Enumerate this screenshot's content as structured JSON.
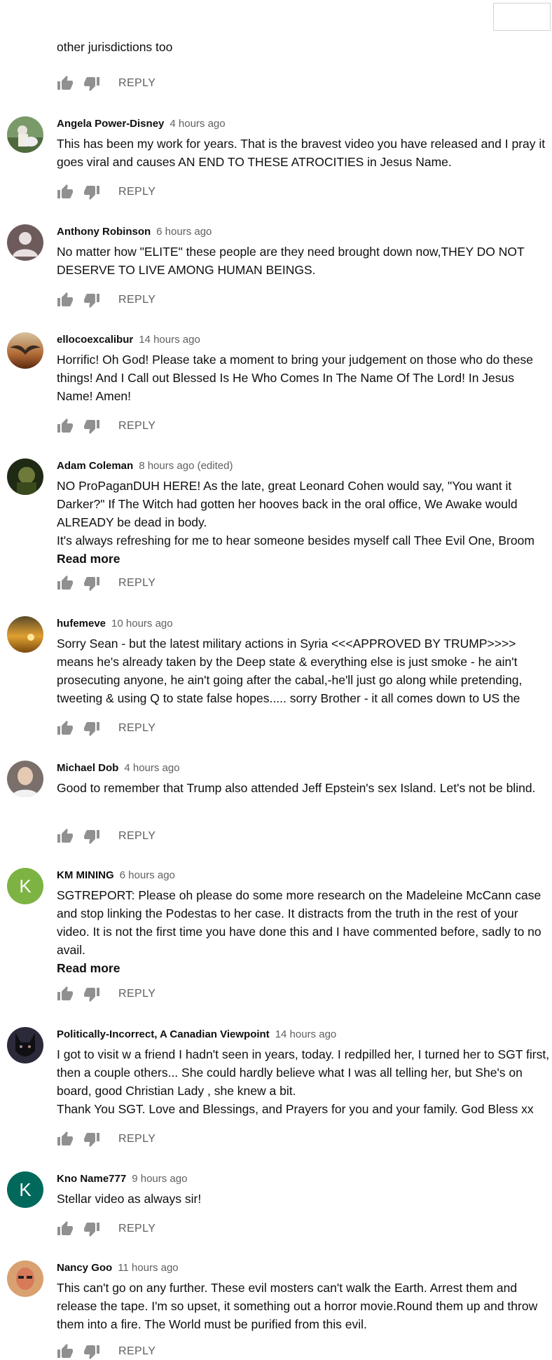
{
  "first": {
    "text": "other jurisdictions too",
    "reply_label": "REPLY"
  },
  "reply_label": "REPLY",
  "read_more_label": "Read more",
  "colors": {
    "like_icon": "#909090",
    "author": "#0f0f0f",
    "time": "#606060",
    "km_avatar": "#7cb342",
    "kno_avatar": "#00695c"
  },
  "comments": [
    {
      "author": "Angela Power-Disney",
      "time": "4 hours ago",
      "lines": [
        "This has been my work for years. That is the bravest video you have released and I pray it goes viral and causes AN END TO THESE ATROCITIES in Jesus Name."
      ],
      "read_more": false
    },
    {
      "author": "Anthony Robinson",
      "time": "6 hours ago",
      "lines": [
        "No matter how \"ELITE\" these people are they need brought down now,THEY DO NOT DESERVE TO LIVE AMONG HUMAN BEINGS."
      ],
      "read_more": false
    },
    {
      "author": "ellocoexcalibur",
      "time": "14 hours ago",
      "lines": [
        "Horrific! Oh God! Please take a moment to bring your judgement on those who do these things! And I Call out Blessed Is He Who Comes In The Name Of The Lord! In Jesus Name! Amen!"
      ],
      "read_more": false
    },
    {
      "author": "Adam Coleman",
      "time": "8 hours ago (edited)",
      "lines": [
        "NO ProPaganDUH HERE! As the late, great Leonard Cohen would say, \"You want it Darker?\" If The Witch had gotten her hooves back in the oral office, We Awake would ALREADY be dead in body.",
        "It's always refreshing for me to hear someone besides myself call Thee Evil One, Broom"
      ],
      "read_more": true
    },
    {
      "author": "hufemeve",
      "time": "10 hours ago",
      "lines": [
        "Sorry Sean - but the latest military actions in Syria <<<APPROVED BY TRUMP>>>> means he's already taken by the Deep state & everything else is just smoke - he ain't prosecuting anyone, he ain't going after the cabal,-he'll just go along while pretending, tweeting & using Q to state false hopes..... sorry Brother - it all comes down to US the"
      ],
      "read_more": false
    },
    {
      "author": "Michael Dob",
      "time": "4 hours ago",
      "lines": [
        "Good to remember that Trump also attended Jeff Epstein's sex Island. Let's not be blind."
      ],
      "read_more": false
    },
    {
      "author": "KM MINING",
      "time": "6 hours ago",
      "avatar_letter": "K",
      "lines": [
        "SGTREPORT:  Please oh please do some more research on the Madeleine McCann case and stop linking the Podestas to her case. It distracts from the truth in the rest of your video. It is not the first time you have done this and I have commented before, sadly to no avail."
      ],
      "read_more": true
    },
    {
      "author": "Politically-Incorrect, A Canadian Viewpoint",
      "time": "14 hours ago",
      "lines": [
        "I got to visit w a friend I hadn't seen in years, today. I redpilled her, I turned her to SGT first, then a couple others... She could hardly believe what I was all telling her, but She's on board, good Christian Lady , she knew a bit.",
        "Thank You SGT.  Love and Blessings,  and Prayers for you and your family.  God Bless xx"
      ],
      "read_more": false
    },
    {
      "author": "Kno Name777",
      "time": "9 hours ago",
      "avatar_letter": "K",
      "lines": [
        "Stellar video as always sir!"
      ],
      "read_more": false
    },
    {
      "author": "Nancy Goo",
      "time": "11 hours ago",
      "lines": [
        "This can't go on any further. These evil mosters can't walk the Earth. Arrest them and release the tape. I'm so upset, it something out a horror movie.Round them up and throw them into a fire. The World must be purified from this evil."
      ],
      "read_more": false
    }
  ]
}
